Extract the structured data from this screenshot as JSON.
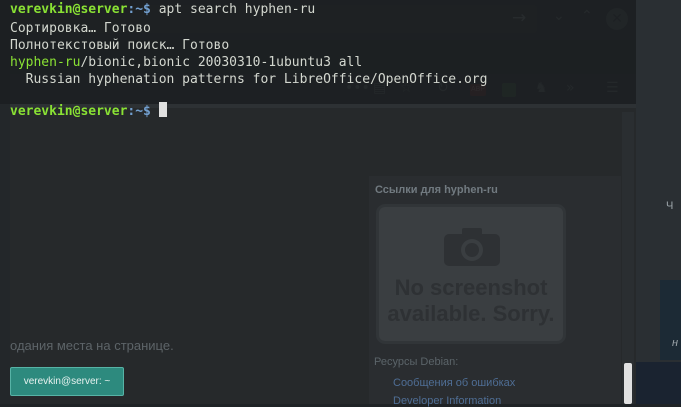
{
  "terminal": {
    "prompt_user": "verevkin@server",
    "prompt_sep": ":~$",
    "command": " apt search hyphen-ru",
    "line_sorting": "Сортировка… Готово",
    "line_search": "Полнотекстовый поиск… Готово",
    "pkg_name": "hyphen-ru",
    "pkg_info": "/bionic,bionic 20030310-1ubuntu3 all",
    "pkg_desc": "  Russian hyphenation patterns for LibreOffice/OpenOffice.org",
    "prompt2_user": "verevkin@server",
    "prompt2_sep": ":~$ "
  },
  "browser": {
    "page_text_fragment": "одания места на странице.",
    "sidebar_title": "Ссылки для hyphen-ru",
    "screenshot_placeholder_line1": "No screenshot",
    "screenshot_placeholder_line2": "available. Sorry.",
    "resources_heading": "Ресурсы Debian:",
    "links": [
      "Сообщения об ошибках",
      "Developer Information"
    ]
  },
  "desktop": {
    "peek_text_1": "Ч",
    "peek_text_2": "н"
  },
  "taskbar": {
    "window_label": "verevkin@server: ~"
  },
  "colors": {
    "terminal_user": "#8ae234",
    "terminal_path": "#729fcf",
    "taskbar_accent": "#2d8a7e"
  }
}
